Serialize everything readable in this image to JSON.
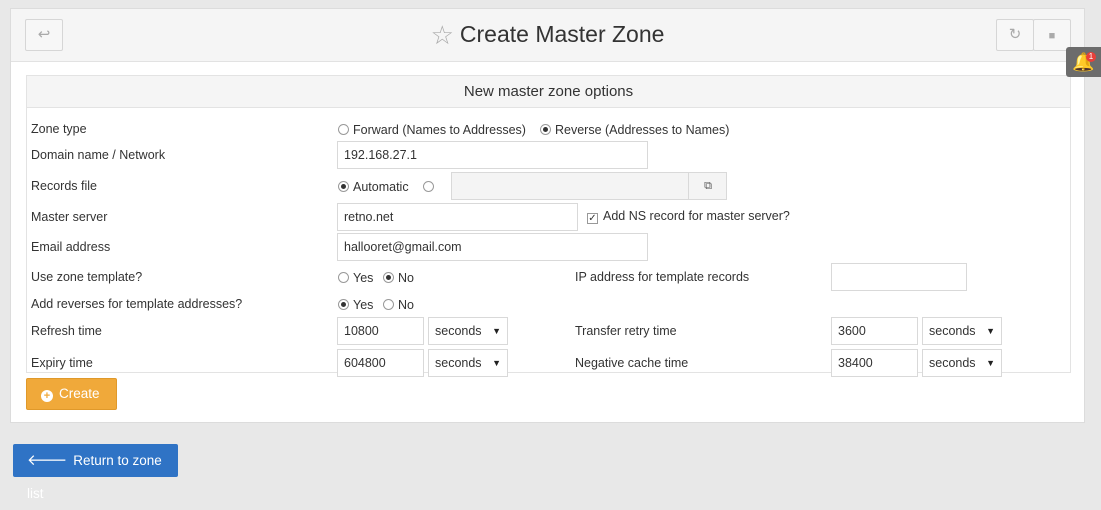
{
  "header": {
    "title": "Create Master Zone",
    "back_icon": "↩",
    "refresh_icon": "↻",
    "stop_icon": "■",
    "star_icon": "☆"
  },
  "notification": {
    "count": "1"
  },
  "form": {
    "heading": "New master zone options",
    "zone_type": {
      "label": "Zone type",
      "forward": "Forward (Names to Addresses)",
      "reverse": "Reverse (Addresses to Names)"
    },
    "domain": {
      "label": "Domain name / Network",
      "value": "192.168.27.1"
    },
    "records_file": {
      "label": "Records file",
      "automatic": "Automatic",
      "value": ""
    },
    "master_server": {
      "label": "Master server",
      "value": "retno.net",
      "ns_record_label": "Add NS record for master server?"
    },
    "email": {
      "label": "Email address",
      "value": "hallooret@gmail.com"
    },
    "zone_template": {
      "label": "Use zone template?",
      "yes": "Yes",
      "no": "No"
    },
    "ip_template": {
      "label": "IP address for template records",
      "value": ""
    },
    "reverses": {
      "label": "Add reverses for template addresses?",
      "yes": "Yes",
      "no": "No"
    },
    "refresh_time": {
      "label": "Refresh time",
      "value": "10800",
      "unit": "seconds"
    },
    "transfer_retry": {
      "label": "Transfer retry time",
      "value": "3600",
      "unit": "seconds"
    },
    "expiry_time": {
      "label": "Expiry time",
      "value": "604800",
      "unit": "seconds"
    },
    "negative_cache": {
      "label": "Negative cache time",
      "value": "38400",
      "unit": "seconds"
    }
  },
  "buttons": {
    "create": "Create",
    "return": "Return to zone list"
  }
}
